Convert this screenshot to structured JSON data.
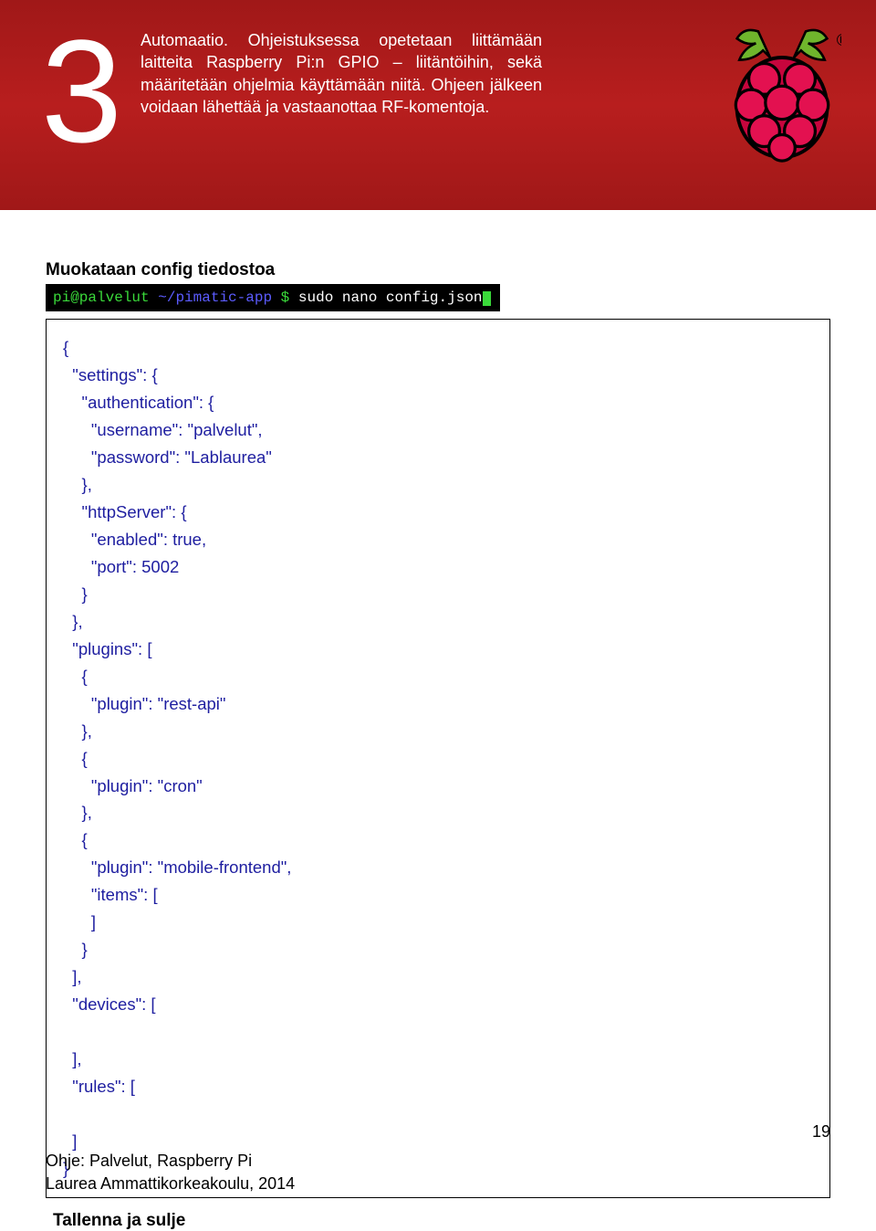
{
  "header": {
    "chapter_number": "3",
    "description": "Automaatio. Ohjeistuksessa opetetaan liittämään laitteita Raspberry Pi:n GPIO – liitäntöihin, sekä määritetään ohjelmia käyttämään niitä. Ohjeen jälkeen voidaan lähettää ja vastaanottaa RF-komentoja.",
    "logo_trademark": "®"
  },
  "section": {
    "title": "Muokataan config tiedostoa",
    "terminal_prompt_user": "pi@palvelut",
    "terminal_prompt_path": "~/pimatic-app",
    "terminal_prompt_dollar": "$",
    "terminal_command": "sudo nano config.json"
  },
  "code_box": "{\n  \"settings\": {\n    \"authentication\": {\n      \"username\": \"palvelut\",\n      \"password\": \"Lablaurea\"\n    },\n    \"httpServer\": {\n      \"enabled\": true,\n      \"port\": 5002\n    }\n  },\n  \"plugins\": [\n    {\n      \"plugin\": \"rest-api\"\n    },\n    {\n      \"plugin\": \"cron\"\n    },\n    {\n      \"plugin\": \"mobile-frontend\",\n      \"items\": [\n      ]\n    }\n  ],\n  \"devices\": [\n\n  ],\n  \"rules\": [\n\n  ]\n}",
  "footer_section_title": "Tallenna ja sulje",
  "page_number": "19",
  "footer": {
    "line1": "Ohje: Palvelut, Raspberry Pi",
    "line2": "Laurea Ammattikorkeakoulu, 2014"
  }
}
